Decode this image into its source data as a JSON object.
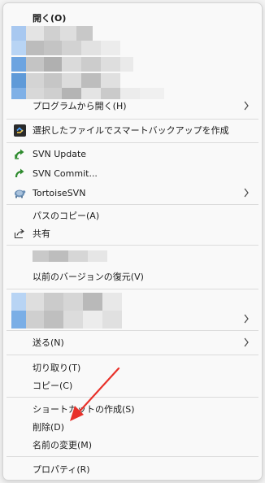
{
  "menu": {
    "open_label": "開く(O)",
    "open_with_label": "プログラムから開く(H)",
    "smart_backup_label": "選択したファイルでスマートバックアップを作成",
    "svn_update_label": "SVN Update",
    "svn_commit_label": "SVN Commit...",
    "tortoisesvn_label": "TortoiseSVN",
    "copy_path_label": "パスのコピー(A)",
    "share_label": "共有",
    "restore_prev_label": "以前のバージョンの復元(V)",
    "send_to_label": "送る(N)",
    "cut_label": "切り取り(T)",
    "copy_label": "コピー(C)",
    "create_shortcut_label": "ショートカットの作成(S)",
    "delete_label": "削除(D)",
    "rename_label": "名前の変更(M)",
    "properties_label": "プロパティ(R)"
  },
  "colors": {
    "arrow": "#e8312a",
    "svn_update_icon": "#2e8b2e",
    "svn_commit_icon": "#2e8b2e"
  }
}
